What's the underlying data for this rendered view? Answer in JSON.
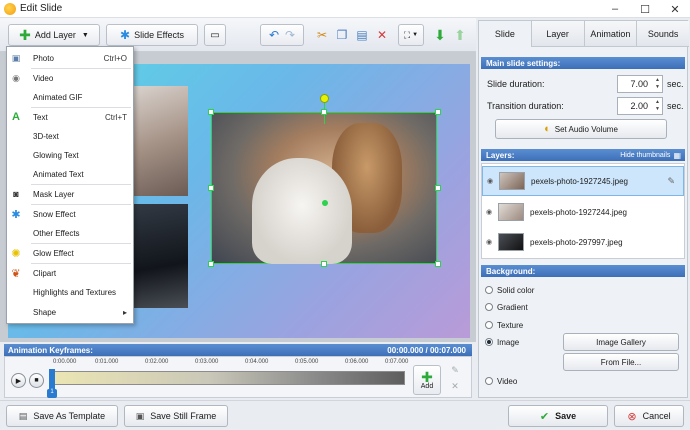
{
  "window": {
    "title": "Edit Slide"
  },
  "toolbar": {
    "add_layer": "Add Layer",
    "slide_effects": "Slide Effects"
  },
  "menu": {
    "items": [
      {
        "label": "Photo",
        "shortcut": "Ctrl+O",
        "icon": "photo-icon"
      },
      {
        "label": "Video",
        "shortcut": "",
        "icon": "video-reel-icon"
      },
      {
        "label": "Animated GIF",
        "shortcut": "",
        "icon": ""
      },
      {
        "label": "Text",
        "shortcut": "Ctrl+T",
        "icon": "text-a-icon"
      },
      {
        "label": "3D-text",
        "shortcut": "",
        "icon": ""
      },
      {
        "label": "Glowing Text",
        "shortcut": "",
        "icon": ""
      },
      {
        "label": "Animated Text",
        "shortcut": "",
        "icon": ""
      },
      {
        "label": "Mask Layer",
        "shortcut": "",
        "icon": "mask-layer-icon"
      },
      {
        "label": "Snow Effect",
        "shortcut": "",
        "icon": "snowflake-icon"
      },
      {
        "label": "Other Effects",
        "shortcut": "",
        "icon": ""
      },
      {
        "label": "Glow Effect",
        "shortcut": "",
        "icon": "glow-icon"
      },
      {
        "label": "Clipart",
        "shortcut": "",
        "icon": "clipart-icon"
      },
      {
        "label": "Highlights and Textures",
        "shortcut": "",
        "icon": ""
      },
      {
        "label": "Shape",
        "shortcut": "▸",
        "icon": ""
      }
    ]
  },
  "keyframes": {
    "title": "Animation Keyframes:",
    "time": "00:00.000 / 00:07.000",
    "ticks": [
      "0:00.000",
      "0:01.000",
      "0:02.000",
      "0:03.000",
      "0:04.000",
      "0:05.000",
      "0:06.000",
      "0:07.000"
    ],
    "marker": "1",
    "add_label": "Add"
  },
  "bottom": {
    "save_template": "Save As Template",
    "save_frame": "Save Still Frame",
    "save": "Save",
    "cancel": "Cancel"
  },
  "tabs": [
    "Slide",
    "Layer",
    "Animation",
    "Sounds"
  ],
  "settings": {
    "header": "Main slide settings:",
    "slide_duration_label": "Slide duration:",
    "slide_duration": "7.00",
    "transition_label": "Transition duration:",
    "transition": "2.00",
    "unit": "sec.",
    "audio_button": "Set Audio Volume"
  },
  "layers": {
    "header": "Layers:",
    "hide_thumbs": "Hide thumbnails",
    "items": [
      "pexels-photo-1927245.jpeg",
      "pexels-photo-1927244.jpeg",
      "pexels-photo-297997.jpeg"
    ]
  },
  "background": {
    "header": "Background:",
    "options": [
      "Solid color",
      "Gradient",
      "Texture",
      "Image",
      "Video"
    ],
    "image_gallery": "Image Gallery",
    "from_file": "From File..."
  },
  "colors": {
    "accent": "#3d6fb8",
    "selection": "#2dd24f",
    "add_green": "#2eaa3a"
  }
}
